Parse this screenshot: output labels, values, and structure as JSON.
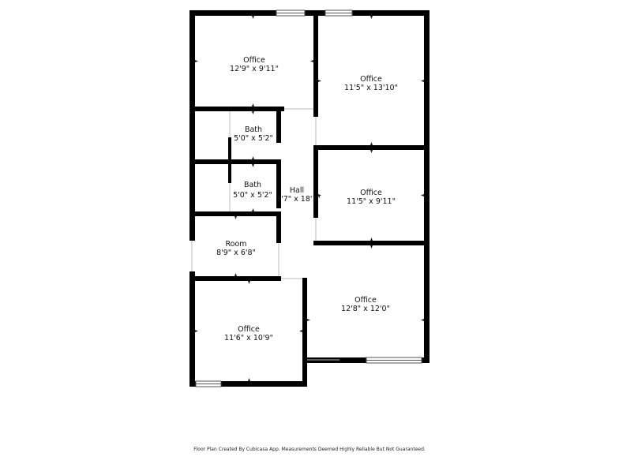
{
  "rooms": [
    {
      "id": "office-nw",
      "name": "Office",
      "dims": "12'9\" x 9'11\""
    },
    {
      "id": "office-ne",
      "name": "Office",
      "dims": "11'5\" x 13'10\""
    },
    {
      "id": "bath-1",
      "name": "Bath",
      "dims": "5'0\" x 5'2\""
    },
    {
      "id": "bath-2",
      "name": "Bath",
      "dims": "5'0\" x 5'2\""
    },
    {
      "id": "hall",
      "name": "Hall",
      "dims": "3'7\" x 18'1\""
    },
    {
      "id": "office-e",
      "name": "Office",
      "dims": "11'5\" x 9'11\""
    },
    {
      "id": "room",
      "name": "Room",
      "dims": "8'9\" x 6'8\""
    },
    {
      "id": "office-se",
      "name": "Office",
      "dims": "12'8\" x 12'0\""
    },
    {
      "id": "office-sw",
      "name": "Office",
      "dims": "11'6\" x 10'9\""
    }
  ],
  "footer": "Floor Plan Created By Cubicasa App. Measurements Deemed Highly Reliable But Not Guaranteed."
}
